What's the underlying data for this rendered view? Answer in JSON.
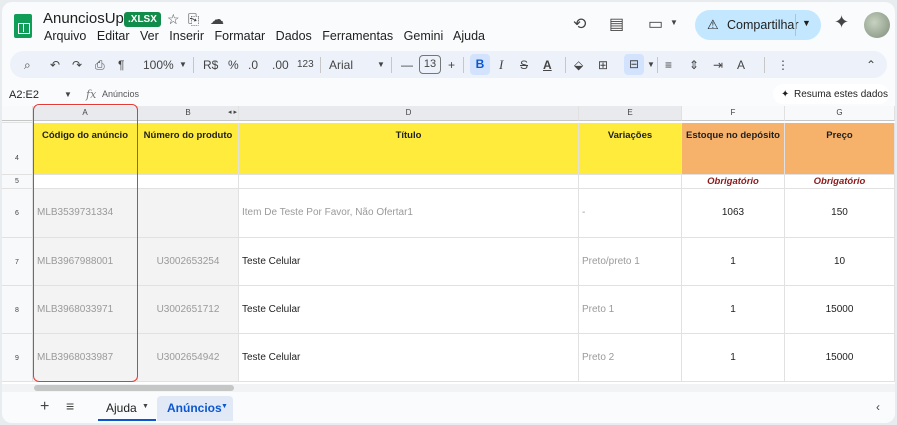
{
  "title_bar": {
    "doc_title": "AnunciosUp",
    "badge": ".XLSX",
    "share_label": "Compartilhar"
  },
  "menu": [
    "Arquivo",
    "Editar",
    "Ver",
    "Inserir",
    "Formatar",
    "Dados",
    "Ferramentas",
    "Gemini",
    "Ajuda"
  ],
  "toolbar": {
    "zoom": "100%",
    "currency": "R$",
    "percent": "%",
    "dec_less": ".0",
    "dec_more": ".00",
    "number_format": "123",
    "font": "Arial",
    "font_size": "13"
  },
  "formula_bar": {
    "cell_ref": "A2:E2",
    "fx": "fx",
    "content": "Anúncios",
    "summarize": "Resuma estes dados"
  },
  "columns": [
    "A",
    "B",
    "D",
    "E",
    "F",
    "G"
  ],
  "header_row": {
    "row_num": "4",
    "cells": [
      "Código do anúncio",
      "Número do produto",
      "Título",
      "Variações",
      "Estoque no depósito",
      "Preço"
    ]
  },
  "required_row": {
    "row_num": "5",
    "required_label": "Obrigatório"
  },
  "rows": [
    {
      "num": "6",
      "code": "MLB3539731334",
      "product": "",
      "title": "Item De Teste  Por Favor, Não Ofertar1",
      "variation": "-",
      "stock": "1063",
      "price": "150"
    },
    {
      "num": "7",
      "code": "MLB3967988001",
      "product": "U3002653254",
      "title": "Teste Celular",
      "variation": "Preto/preto 1",
      "stock": "1",
      "price": "10"
    },
    {
      "num": "8",
      "code": "MLB3968033971",
      "product": "U3002651712",
      "title": "Teste Celular",
      "variation": "Preto 1",
      "stock": "1",
      "price": "15000"
    },
    {
      "num": "9",
      "code": "MLB3968033987",
      "product": "U3002654942",
      "title": "Teste Celular",
      "variation": "Preto 2",
      "stock": "1",
      "price": "15000"
    }
  ],
  "sheet_tabs": [
    "Ajuda",
    "Anúncios"
  ],
  "colors": {
    "header_yellow": "#ffeb3b",
    "header_orange": "#f6b26b",
    "required_text": "#8b1a1a",
    "highlight_box": "#e53935",
    "share_bg": "#c2e7ff"
  }
}
